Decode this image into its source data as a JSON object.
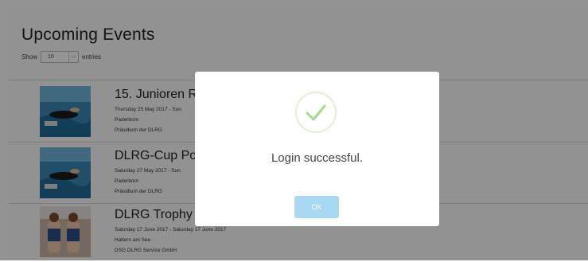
{
  "page": {
    "title": "Upcoming Events",
    "show_label": "Show",
    "entries_value": "10",
    "entries_label": "entries"
  },
  "events": [
    {
      "title": "15. Junioren R",
      "date": "Thursday 25 May 2017 - Sun",
      "location": "Paderborn",
      "organizer": "Präsidium der DLRG",
      "image": "underwater-rescue-photo"
    },
    {
      "title": "DLRG-Cup Po",
      "date": "Saturday 27 May 2017 - Sun",
      "location": "Paderborn",
      "organizer": "Präsidium der DLRG",
      "image": "underwater-rescue-photo"
    },
    {
      "title": "DLRG Trophy",
      "date": "Saturday 17 June 2017 - Saturday 17 June 2017",
      "location": "Haltern am See",
      "organizer": "DSG DLRG Service GmbH",
      "image": "lifeguard-team-photo"
    }
  ],
  "modal": {
    "icon": "check-icon",
    "message": "Login successful.",
    "ok_label": "OK",
    "colors": {
      "check": "#a5dc86",
      "ok_button": "#a8d8f2"
    }
  }
}
